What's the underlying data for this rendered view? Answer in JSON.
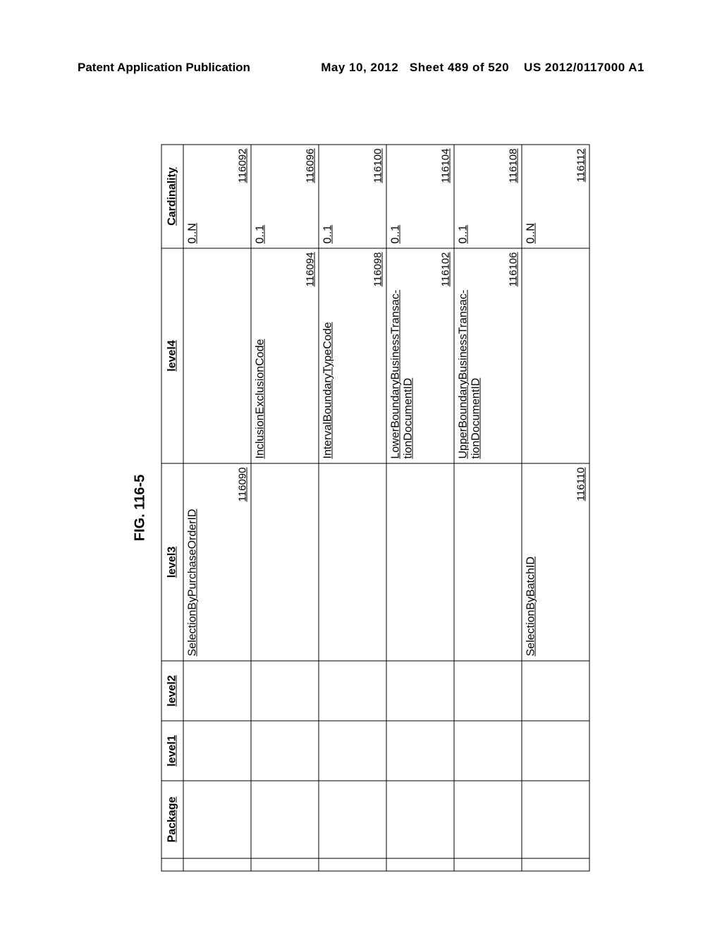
{
  "header": {
    "left": "Patent Application Publication",
    "date": "May 10, 2012",
    "sheet": "Sheet 489 of 520",
    "docnum": "US 2012/0117000 A1"
  },
  "figure": {
    "title": "FIG. 116-5",
    "columns": {
      "package": "Package",
      "level1": "level1",
      "level2": "level2",
      "level3": "level3",
      "level4": "level4",
      "cardinality": "Cardinality"
    },
    "rows": [
      {
        "level3": {
          "label": "SelectionByPurchaseOrderID",
          "ref": "116090"
        },
        "level4": null,
        "card": {
          "label": "0..N",
          "ref": "116092"
        }
      },
      {
        "level3": null,
        "level4": {
          "label": "InclusionExclusionCode",
          "ref": "116094"
        },
        "card": {
          "label": "0..1",
          "ref": "116096"
        }
      },
      {
        "level3": null,
        "level4": {
          "label": "IntervalBoundaryTypeCode",
          "ref": "116098"
        },
        "card": {
          "label": "0..1",
          "ref": "116100"
        }
      },
      {
        "level3": null,
        "level4": {
          "label": "LowerBoundaryBusinessTransactionDocumentID",
          "ref": "116102"
        },
        "card": {
          "label": "0..1",
          "ref": "116104"
        }
      },
      {
        "level3": null,
        "level4": {
          "label": "UpperBoundaryBusinessTransactionDocumentID",
          "ref": "116106"
        },
        "card": {
          "label": "0..1",
          "ref": "116108"
        }
      },
      {
        "level3": {
          "label": "SelectionByBatchID",
          "ref": "116110"
        },
        "level4": null,
        "card": {
          "label": "0..N",
          "ref": "116112"
        }
      }
    ]
  }
}
